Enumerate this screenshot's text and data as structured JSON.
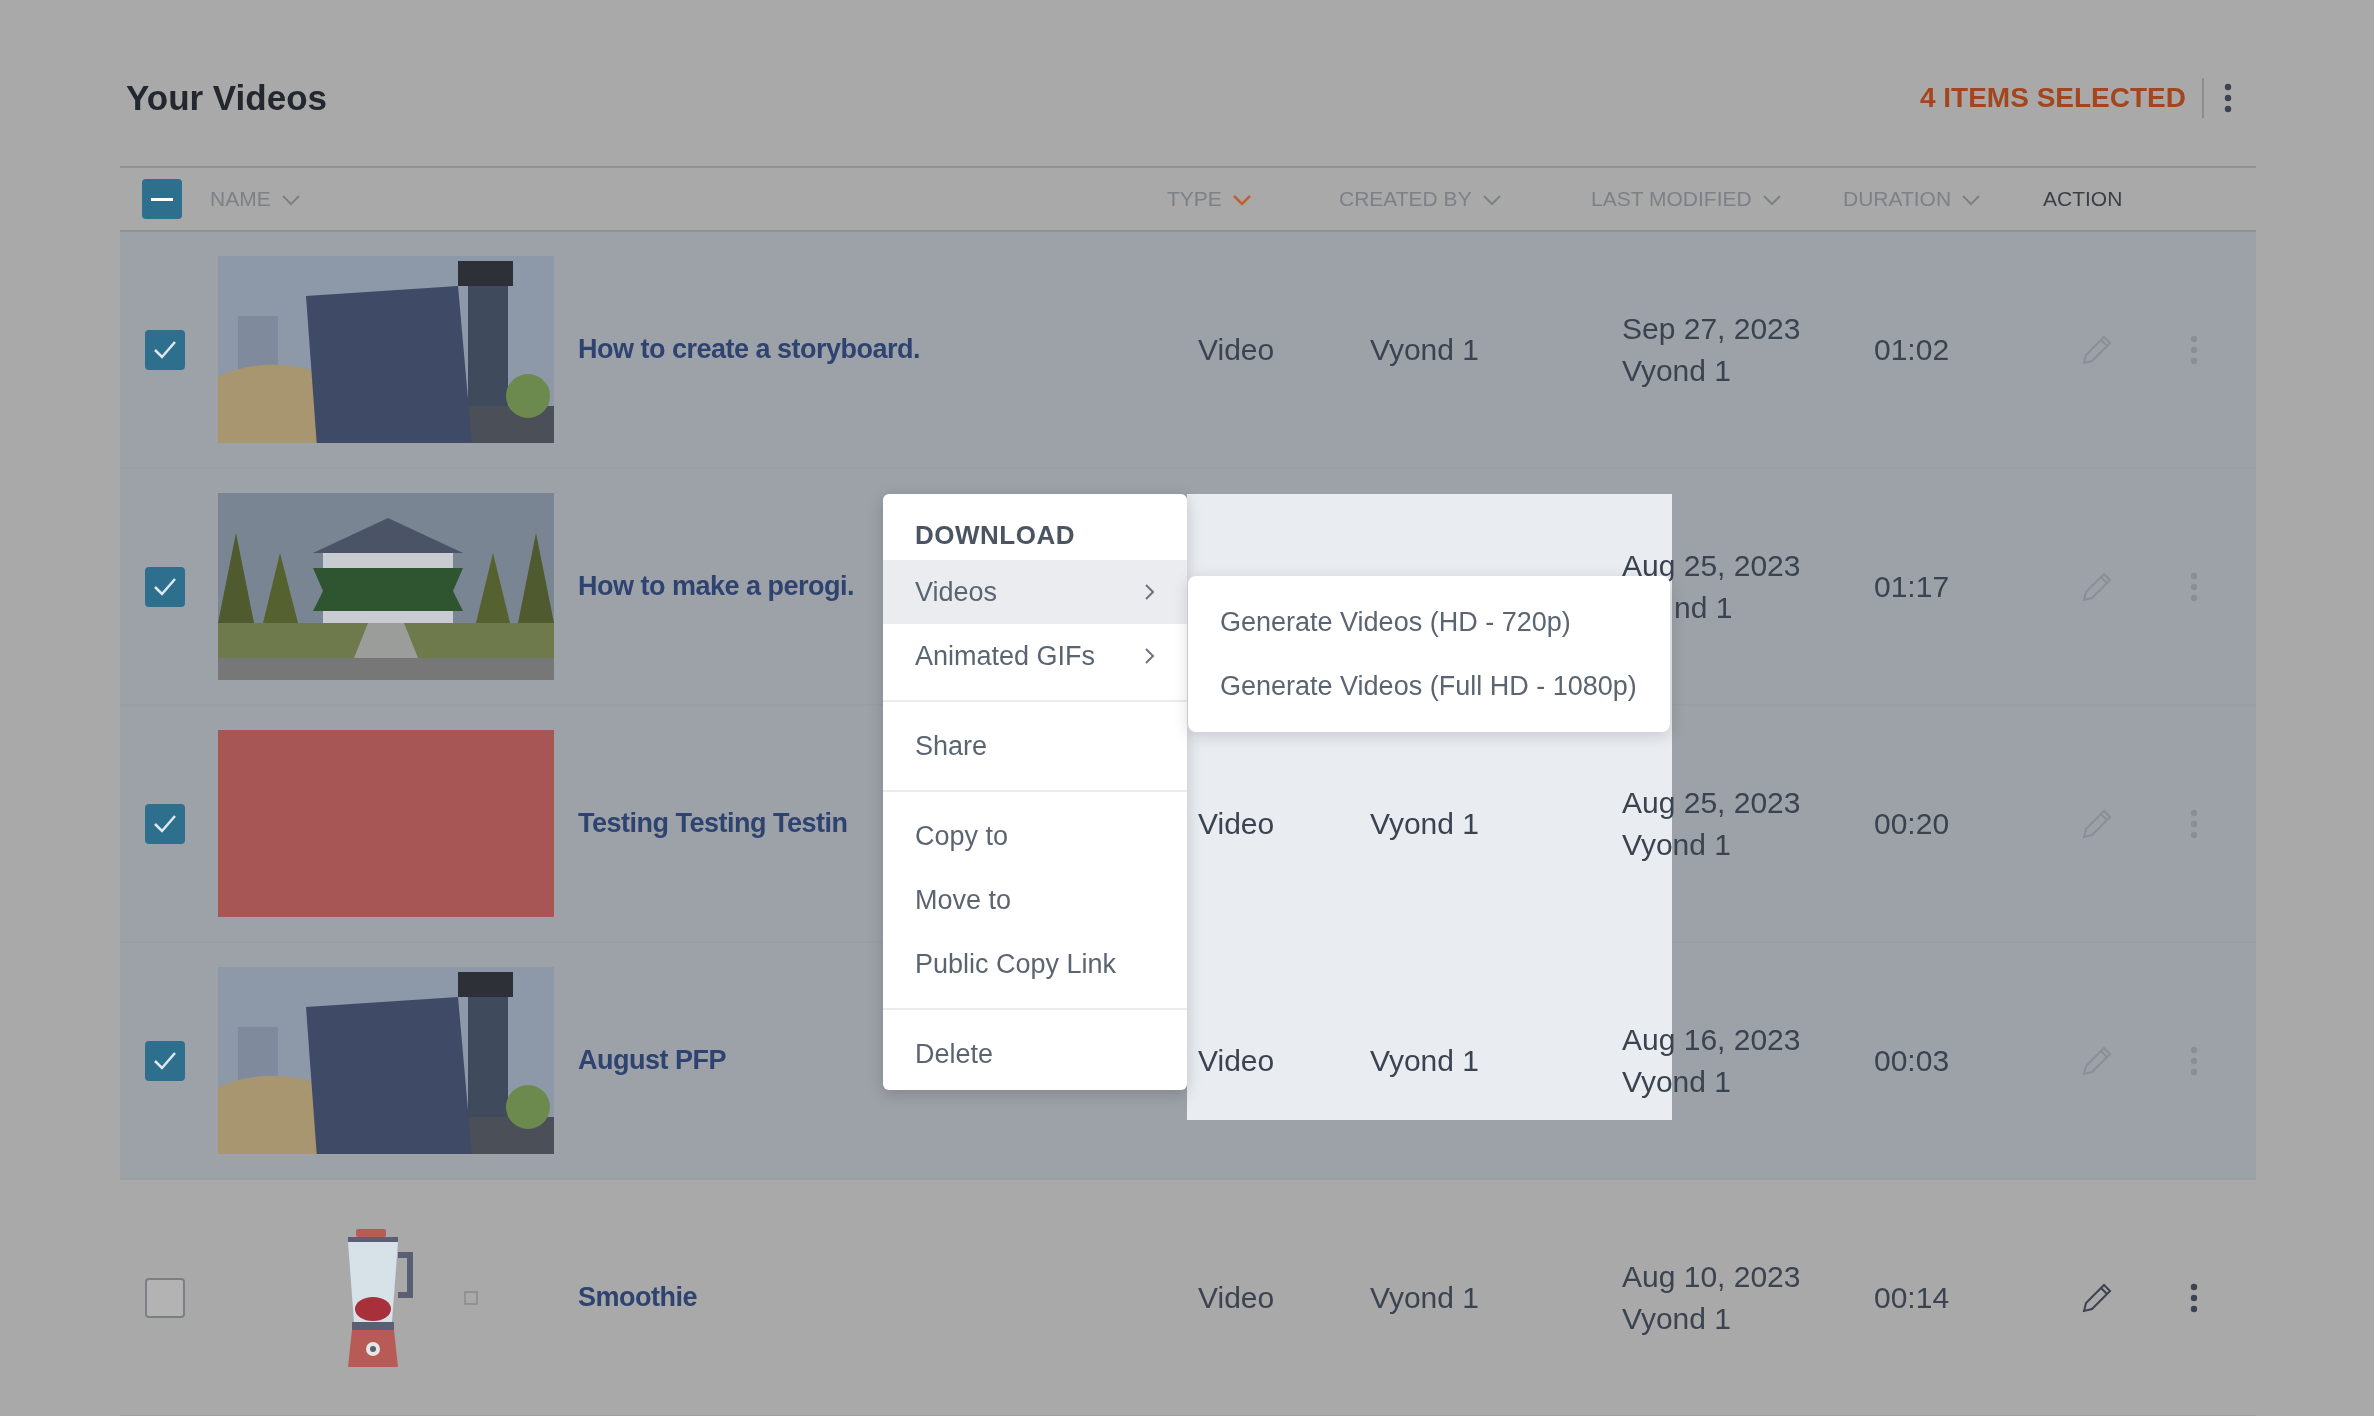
{
  "header": {
    "title": "Your Videos",
    "selection_label": "4 ITEMS SELECTED"
  },
  "table": {
    "select_all": {
      "indeterminate": true
    },
    "columns": [
      {
        "label": "NAME",
        "sortable": true,
        "sorted": false
      },
      {
        "label": "TYPE",
        "sortable": true,
        "sorted": true
      },
      {
        "label": "CREATED BY",
        "sortable": true,
        "sorted": false
      },
      {
        "label": "LAST MODIFIED",
        "sortable": true,
        "sorted": false
      },
      {
        "label": "DURATION",
        "sortable": true,
        "sorted": false
      },
      {
        "label": "ACTION",
        "sortable": false
      }
    ],
    "rows": [
      {
        "selected": true,
        "name": "How to create a storyboard.",
        "type": "Video",
        "created_by": "Vyond 1",
        "modified_date": "Sep 27, 2023",
        "modified_by": "Vyond 1",
        "duration": "01:02"
      },
      {
        "selected": true,
        "name": "How to make a perogi.",
        "modified_date": "Aug 25, 2023",
        "modified_by": "nd 1",
        "modified_by_partly_hidden": true,
        "duration": "01:17"
      },
      {
        "selected": true,
        "thumbnail": {
          "kind": "solid",
          "color": "#a85556"
        },
        "name": "Testing Testing Testin",
        "type": "Video",
        "created_by": "Vyond 1",
        "modified_date": "Aug 25, 2023",
        "modified_by": "Vyond 1",
        "duration": "00:20"
      },
      {
        "selected": true,
        "name": "August PFP",
        "type": "Video",
        "created_by": "Vyond 1",
        "modified_date": "Aug 16, 2023",
        "modified_by": "Vyond 1",
        "duration": "00:03"
      },
      {
        "selected": false,
        "thumbnail": {
          "kind": "drawing"
        },
        "name": "Smoothie",
        "type": "Video",
        "created_by": "Vyond 1",
        "modified_date": "Aug 10, 2023",
        "modified_by": "Vyond 1",
        "duration": "00:14"
      }
    ]
  },
  "context_menu": {
    "heading": "DOWNLOAD",
    "groups": [
      [
        {
          "label": "Videos",
          "has_submenu": true,
          "selected": true
        },
        {
          "label": "Animated GIFs",
          "has_submenu": true,
          "selected": false
        }
      ],
      [
        {
          "label": "Share",
          "has_submenu": false,
          "selected": false
        }
      ],
      [
        {
          "label": "Copy to",
          "has_submenu": false,
          "selected": false
        },
        {
          "label": "Move to",
          "has_submenu": false,
          "selected": false
        },
        {
          "label": "Public Copy Link",
          "has_submenu": false,
          "selected": false
        }
      ],
      [
        {
          "label": "Delete",
          "has_submenu": false,
          "selected": false
        }
      ]
    ]
  },
  "submenu": {
    "items": [
      "Generate Videos (HD - 720p)",
      "Generate Videos (Full HD - 1080p)"
    ]
  }
}
